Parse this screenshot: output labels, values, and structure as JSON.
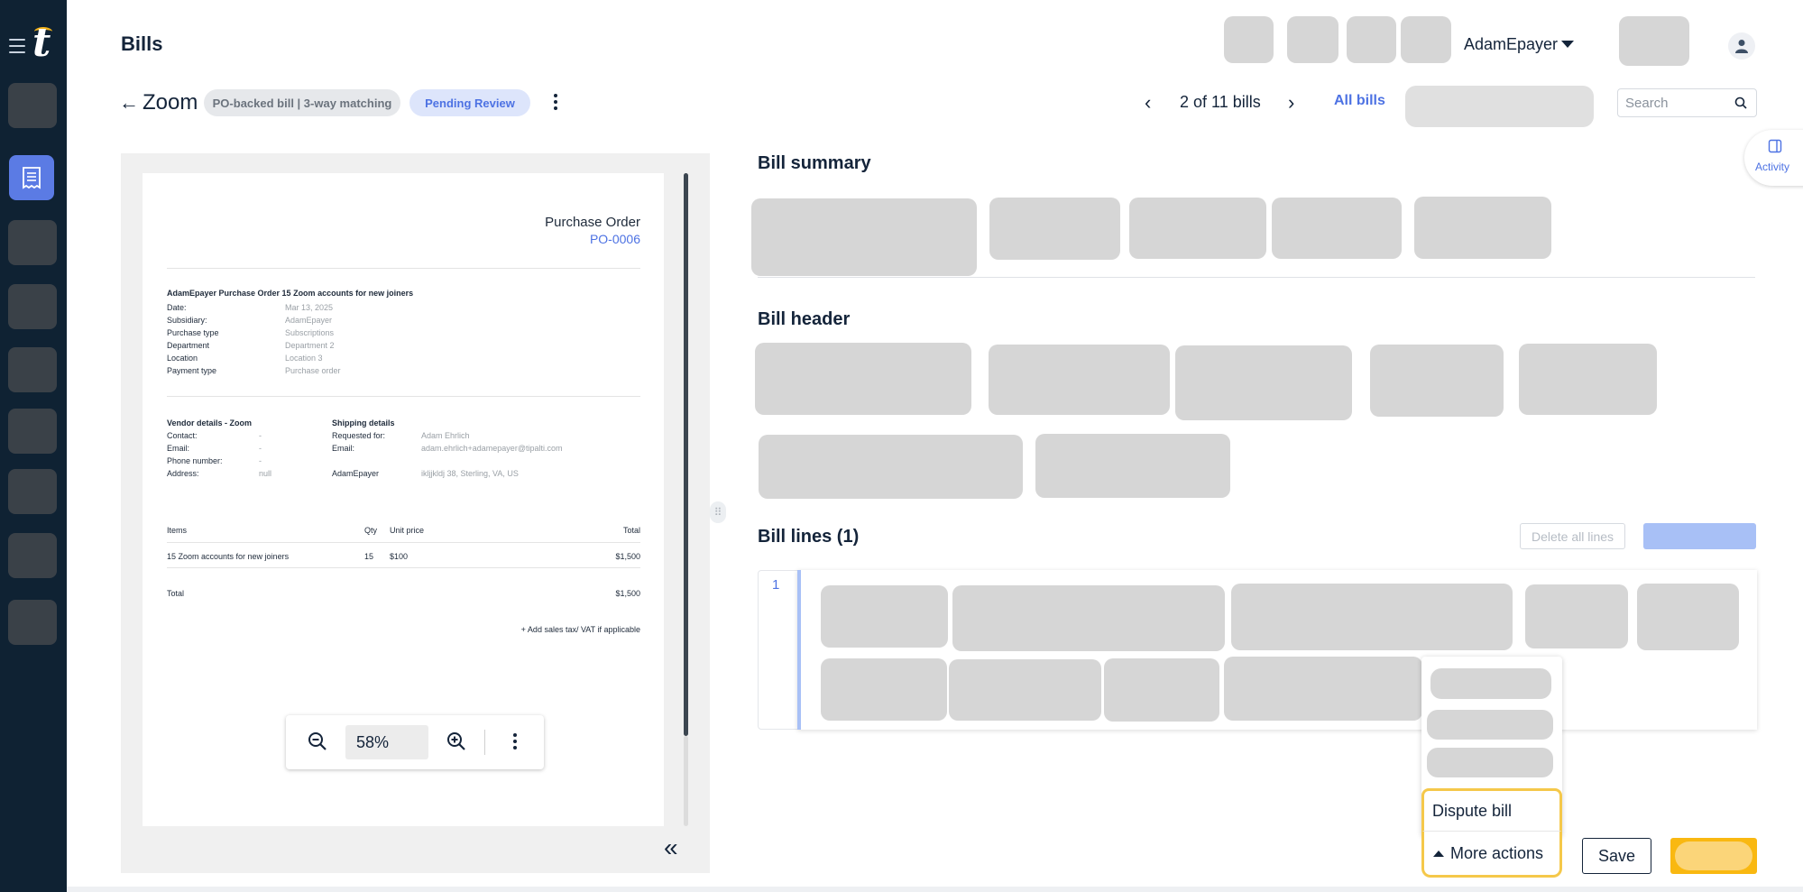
{
  "header": {
    "title": "Bills",
    "user_name": "AdamEpayer"
  },
  "bill": {
    "vendor": "Zoom",
    "type_chip": "PO-backed bill | 3-way matching",
    "status_chip": "Pending Review"
  },
  "pager": {
    "text": "2 of 11 bills",
    "all_bills_label": "All bills"
  },
  "search": {
    "placeholder": "Search"
  },
  "activity_label": "Activity",
  "document": {
    "heading": "Purchase Order",
    "po_number": "PO-0006",
    "title": "AdamEpayer Purchase Order 15 Zoom accounts for new joiners",
    "fields": [
      {
        "label": "Date:",
        "value": "Mar 13, 2025"
      },
      {
        "label": "Subsidiary:",
        "value": "AdamEpayer"
      },
      {
        "label": "Purchase type",
        "value": "Subscriptions"
      },
      {
        "label": "Department",
        "value": "Department 2"
      },
      {
        "label": "Location",
        "value": "Location 3"
      },
      {
        "label": "Payment type",
        "value": "Purchase order"
      }
    ],
    "vendor_heading": "Vendor details - Zoom",
    "vendor_fields": [
      {
        "label": "Contact:",
        "value": "-"
      },
      {
        "label": "Email:",
        "value": "-"
      },
      {
        "label": "Phone number:",
        "value": "-"
      },
      {
        "label": "Address:",
        "value": "null"
      }
    ],
    "shipping_heading": "Shipping details",
    "shipping_fields": [
      {
        "label": "Requested for:",
        "value": "Adam Ehrlich"
      },
      {
        "label": "Email:",
        "value": "adam.ehrlich+adamepayer@tipalti.com"
      },
      {
        "label": "AdamEpayer",
        "value": "ikljjkldj 38, Sterling, VA, US"
      }
    ],
    "table_headers": {
      "items": "Items",
      "qty": "Qty",
      "unit_price": "Unit price",
      "total": "Total"
    },
    "table_rows": [
      {
        "item": "15 Zoom accounts for new joiners",
        "qty": "15",
        "unit_price": "$100",
        "total": "$1,500"
      }
    ],
    "total_label": "Total",
    "total_value": "$1,500",
    "tax_note": "+ Add sales tax/ VAT if applicable"
  },
  "zoom": {
    "level": "58%"
  },
  "sections": {
    "summary": "Bill summary",
    "header": "Bill header",
    "lines": "Bill lines (1)"
  },
  "lines": {
    "delete_all_label": "Delete all lines",
    "first_line_number": "1"
  },
  "actions": {
    "dispute_label": "Dispute bill",
    "more_actions_label": "More actions",
    "save_label": "Save"
  },
  "colors": {
    "sidebar_bg": "#0f2233",
    "accent_blue": "#4d72e3",
    "highlight_yellow": "#f5c84a",
    "submit_yellow": "#f9b811"
  }
}
